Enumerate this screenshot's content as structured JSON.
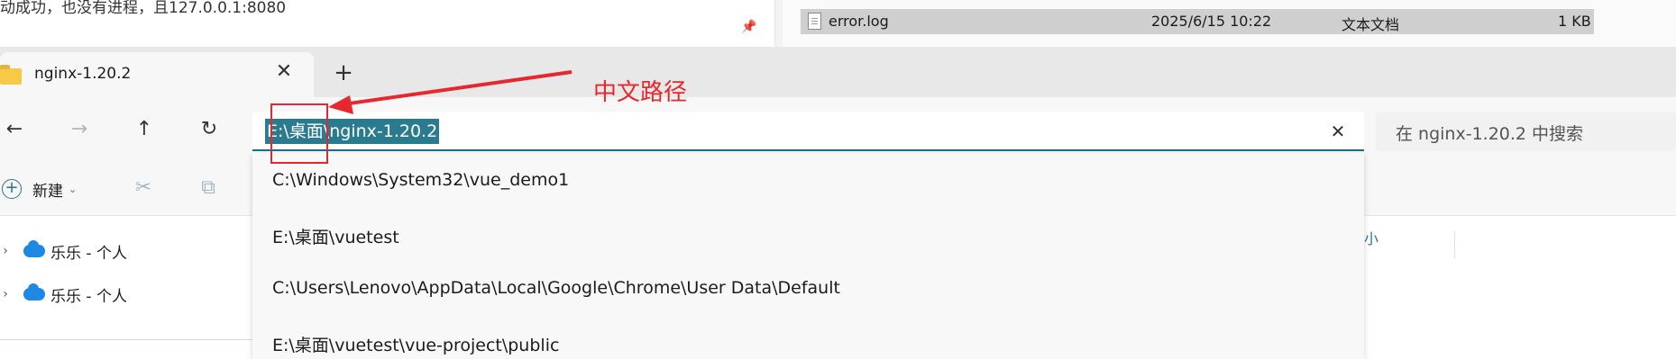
{
  "background": {
    "text": "动成功，也没有进程，且127.0.0.1:8080",
    "file_row": {
      "name": "error.log",
      "modified": "2025/6/15 10:22",
      "type": "文本文档",
      "size": "1 KB"
    }
  },
  "tab": {
    "title": "nginx-1.20.2",
    "close": "✕",
    "new": "+"
  },
  "nav": {
    "back": "←",
    "forward": "→",
    "up": "↑",
    "refresh": "↻"
  },
  "address": {
    "value": "E:\\桌面\\nginx-1.20.2",
    "clear": "✕"
  },
  "search": {
    "placeholder": "在 nginx-1.20.2 中搜索"
  },
  "commandbar": {
    "new_label": "新建",
    "new_icon": "+",
    "caret": "⌄",
    "cut_icon": "✂",
    "copy_icon": "⧉"
  },
  "tree": {
    "items": [
      {
        "caret": "›",
        "label": "乐乐 - 个人"
      },
      {
        "caret": "›",
        "label": "乐乐 - 个人"
      }
    ]
  },
  "right_col_label": "小",
  "dropdown": {
    "items": [
      "C:\\Windows\\System32\\vue_demo1",
      "E:\\桌面\\vuetest",
      "C:\\Users\\Lenovo\\AppData\\Local\\Google\\Chrome\\User Data\\Default",
      "E:\\桌面\\vuetest\\vue-project\\public"
    ]
  },
  "annotation": {
    "label": "中文路径",
    "color": "#e6282e"
  },
  "colors": {
    "selection": "#2a7b90",
    "accent": "#1f6e83",
    "folder": "#f7c948",
    "onedrive": "#1e88e5"
  }
}
